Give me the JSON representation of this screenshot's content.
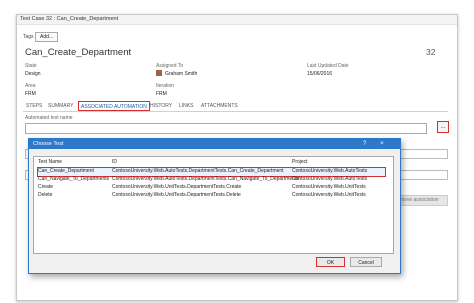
{
  "window": {
    "title": "Test Case 32 : Can_Create_Department"
  },
  "tags": {
    "label": "Tags",
    "add_button": "Add..."
  },
  "work_item": {
    "title": "Can_Create_Department",
    "id": "32"
  },
  "fields": {
    "state": {
      "label": "State",
      "value": "Design"
    },
    "assigned_to": {
      "label": "Assigned To",
      "value": "Graham Smith"
    },
    "last_updated": {
      "label": "Last Updated Date",
      "value": "15/06/2016"
    },
    "area": {
      "label": "Area",
      "value": "FRM"
    },
    "iteration": {
      "label": "Iteration",
      "value": "FRM"
    }
  },
  "tabs": [
    "STEPS",
    "SUMMARY",
    "ASSOCIATED AUTOMATION",
    "HISTORY",
    "LINKS",
    "ATTACHMENTS"
  ],
  "automation": {
    "test_name_label": "Automated test name",
    "browse_label": "...",
    "remove_button": "Remove association"
  },
  "dialog": {
    "title": "Choose Test",
    "help_icon": "?",
    "close_icon": "×",
    "columns": [
      "Test Name",
      "ID",
      "Project"
    ],
    "rows": [
      [
        "Can_Create_Department",
        "ContosoUniversity.Web.AutoTests.DepartmentTests.Can_Create_Department",
        "ContosoUniversity.Web.AutoTests"
      ],
      [
        "Can_Navigate_To_Departments",
        "ContosoUniversity.Web.AutoTests.DepartmentTests.Can_Navigate_To_Departments",
        "ContosoUniversity.Web.AutoTests"
      ],
      [
        "Create",
        "ContosoUniversity.Web.UnitTests.DepartmentTests.Create",
        "ContosoUniversity.Web.UnitTests"
      ],
      [
        "Delete",
        "ContosoUniversity.Web.UnitTests.DepartmentTests.Delete",
        "ContosoUniversity.Web.UnitTests"
      ]
    ],
    "ok_button": "OK",
    "cancel_button": "Cancel"
  },
  "colors": {
    "accent": "#2b79c8",
    "highlight_border": "#d43030"
  }
}
